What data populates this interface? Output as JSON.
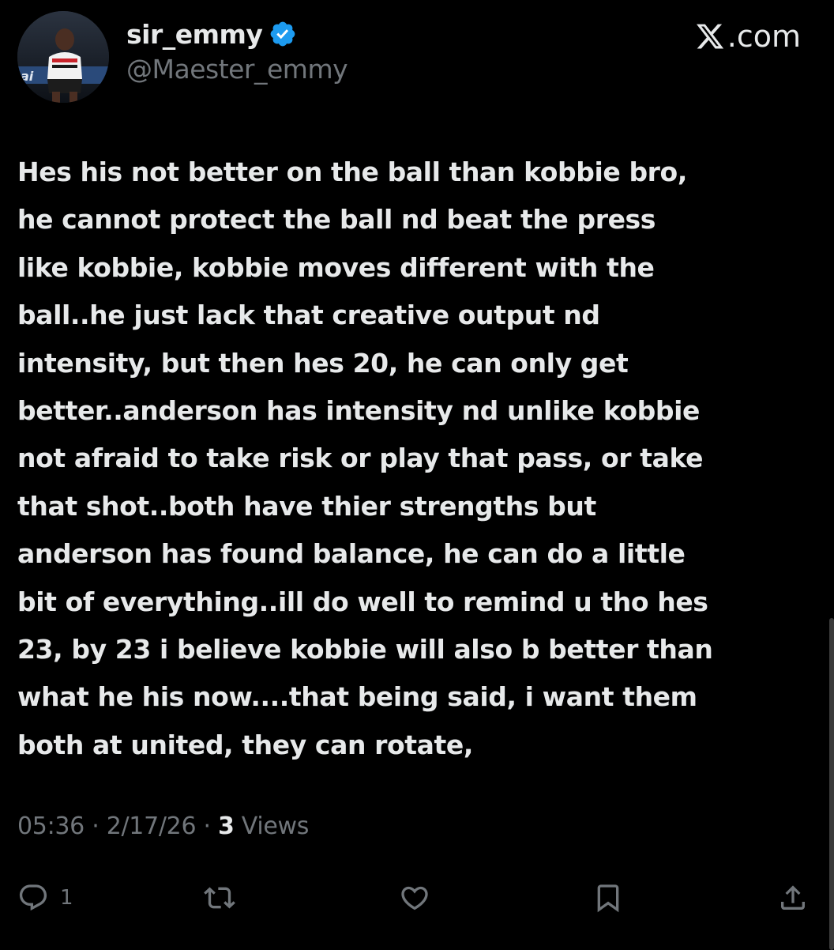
{
  "author": {
    "display_name": "sir_emmy",
    "handle": "@Maester_emmy",
    "verified": true,
    "avatar_icon": "profile-photo-footballer"
  },
  "brand": {
    "label": ".com",
    "icon": "x-logo-icon"
  },
  "tweet": {
    "text": "Hes his not better on the ball than kobbie bro,\nhe cannot protect the ball nd beat the press\nlike kobbie, kobbie moves different with the\nball..he just lack that creative output nd\nintensity, but then hes 20, he can only get\nbetter..anderson has intensity nd unlike kobbie\nnot afraid to take risk or play that pass, or take\nthat shot..both have thier strengths but\nanderson has found balance, he can do a little\nbit of everything..ill do well to remind u tho hes\n23, by 23 i believe kobbie will also b better than\nwhat he his now....that being said, i want them\nboth at united, they can rotate,"
  },
  "meta": {
    "time": "05:36",
    "separator": " · ",
    "date": "2/17/26",
    "views_count": "3",
    "views_label": " Views"
  },
  "actions": {
    "reply_count": "1",
    "icons": [
      "reply-icon",
      "repost-icon",
      "like-icon",
      "bookmark-icon",
      "share-icon"
    ]
  },
  "colors": {
    "background": "#000000",
    "primary_text": "#e7e9ea",
    "secondary_text": "#71767b",
    "verified_badge": "#1d9bf0"
  }
}
